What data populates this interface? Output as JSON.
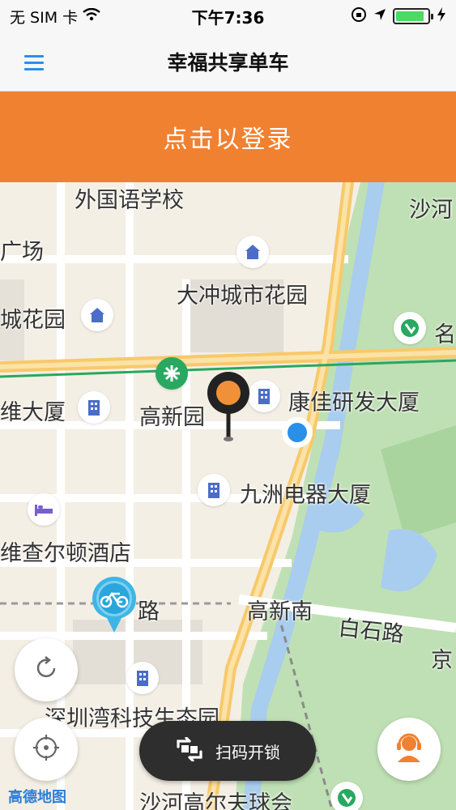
{
  "status_bar": {
    "carrier": "无 SIM 卡",
    "time": "下午7:36",
    "battery_level": 0.9,
    "icons": [
      "wifi-icon",
      "orientation-lock-icon",
      "location-arrow-icon",
      "battery-icon",
      "charging-icon"
    ]
  },
  "nav": {
    "title": "幸福共享单车",
    "menu_icon": "hamburger-menu-icon"
  },
  "login": {
    "label": "点击以登录"
  },
  "map": {
    "labels": {
      "school": "外国语学校",
      "plaza": "广场",
      "dachong": "大冲城市花园",
      "garden": "城花园",
      "gaoxinyuan": "高新园",
      "kangjia": "康佳研发大厦",
      "building_left": "维大厦",
      "jiuzhou": "九洲电器大厦",
      "hotel": "维查尔顿酒店",
      "road1": "路",
      "gaoxinnan": "高新南",
      "baishi": "白石路",
      "jing": "京",
      "ecopark": "深圳湾科技生态园",
      "golf": "沙河高尔夫球会",
      "shahe": "沙河",
      "ming": "名"
    },
    "logo": "高德地图",
    "colors": {
      "park": "#bfe0b4",
      "river": "#a9cdee",
      "road_main": "#f7c96b",
      "metro": "#28a860"
    }
  },
  "controls": {
    "refresh_icon": "refresh-icon",
    "locate_icon": "locate-crosshair-icon",
    "service_icon": "customer-service-icon",
    "scan_label": "扫码开锁",
    "scan_icon": "scan-icon"
  },
  "accent": "#f08130"
}
